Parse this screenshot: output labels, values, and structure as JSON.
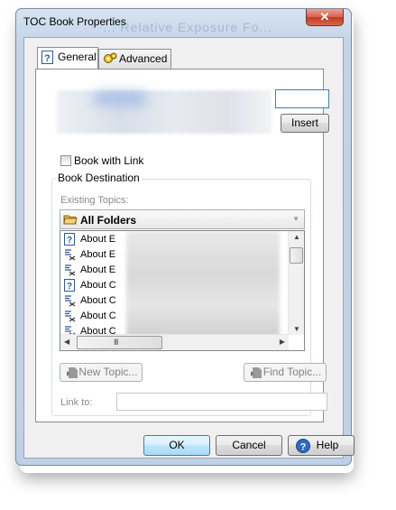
{
  "window": {
    "title": "TOC Book Properties",
    "ghost_title": "... Relative Exposure Fo...",
    "close_glyph": "✕"
  },
  "tabs": [
    {
      "label": "General",
      "icon": "help-topic-icon",
      "active": true
    },
    {
      "label": "Advanced",
      "icon": "gears-icon",
      "active": false
    }
  ],
  "general": {
    "insert_label": "Insert",
    "book_with_link_label": "Book with Link",
    "book_with_link_checked": false,
    "book_destination_label": "Book Destination",
    "existing_topics_label": "Existing Topics:",
    "folder_selected": "All Folders",
    "topics": [
      {
        "text": "About E",
        "icon": "help-topic-icon"
      },
      {
        "text": "About E",
        "icon": "link-topic-icon"
      },
      {
        "text": "About E",
        "icon": "link-topic-icon"
      },
      {
        "text": "About C",
        "icon": "help-topic-icon"
      },
      {
        "text": "About C",
        "icon": "link-topic-icon"
      },
      {
        "text": "About C",
        "icon": "link-topic-icon"
      },
      {
        "text": "About C",
        "icon": "link-topic-icon"
      }
    ],
    "scroll_grip": "III",
    "new_topic_label": "New Topic...",
    "find_topic_label": "Find Topic...",
    "link_to_label": "Link to:",
    "link_to_value": ""
  },
  "footer": {
    "ok_label": "OK",
    "cancel_label": "Cancel",
    "help_label": "Help"
  },
  "colors": {
    "accent": "#3c7fb1",
    "close": "#c23a22"
  }
}
